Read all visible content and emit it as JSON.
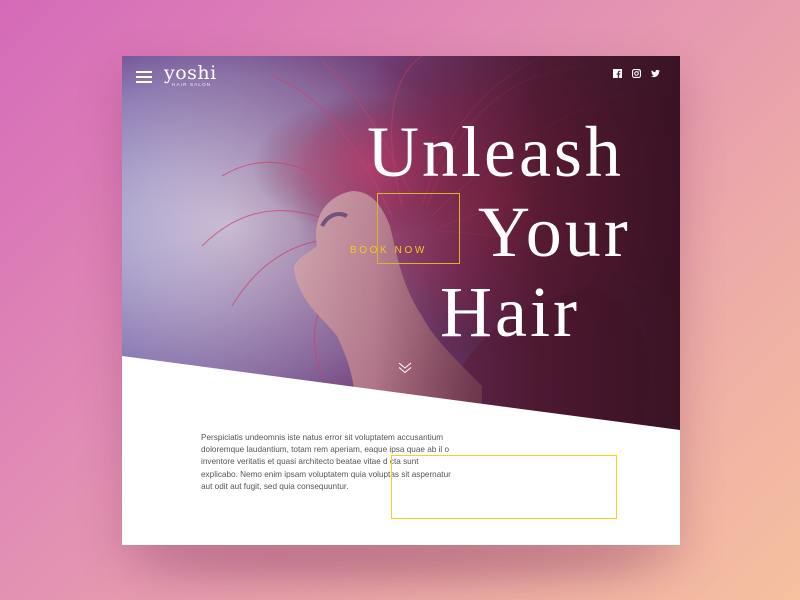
{
  "brand": {
    "name": "yoshi",
    "tagline": "HAIR SALON"
  },
  "nav": {
    "menu_icon": "hamburger-menu-icon",
    "social": [
      {
        "name": "facebook-icon"
      },
      {
        "name": "instagram-icon"
      },
      {
        "name": "twitter-icon"
      }
    ]
  },
  "hero": {
    "headline": [
      "Unleash",
      "Your",
      "Hair"
    ],
    "cta_label": "BOOK NOW",
    "scroll_icon": "chevron-down-icon"
  },
  "content": {
    "paragraph": "Perspiciatis undeomnis iste natus error sit voluptatem accusantium doloremque laudantium, totam rem aperiam, eaque ipsa quae ab il o inventore veritatis et quasi architecto beatae vitae d cta sunt explicabo. Nemo enim ipsam voluptatem quia voluptas sit aspernatur aut odit aut fugit, sed quia consequuntur."
  },
  "colors": {
    "accent": "#f2c81c",
    "background_start": "#d56ab9",
    "background_end": "#f6c09f",
    "text": "#555555"
  }
}
